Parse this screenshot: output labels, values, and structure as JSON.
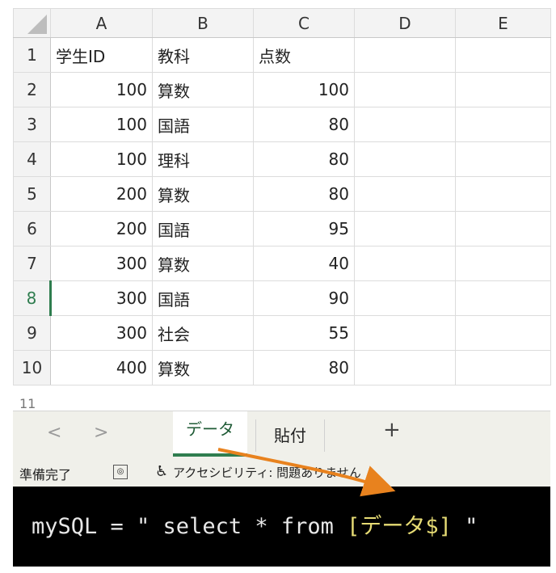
{
  "columns": [
    "A",
    "B",
    "C",
    "D",
    "E"
  ],
  "rows": [
    {
      "num": "1",
      "a": "学生ID",
      "b": "教科",
      "c": "点数"
    },
    {
      "num": "2",
      "a": "100",
      "b": "算数",
      "c": "100"
    },
    {
      "num": "3",
      "a": "100",
      "b": "国語",
      "c": "80"
    },
    {
      "num": "4",
      "a": "100",
      "b": "理科",
      "c": "80"
    },
    {
      "num": "5",
      "a": "200",
      "b": "算数",
      "c": "80"
    },
    {
      "num": "6",
      "a": "200",
      "b": "国語",
      "c": "95"
    },
    {
      "num": "7",
      "a": "300",
      "b": "算数",
      "c": "40"
    },
    {
      "num": "8",
      "a": "300",
      "b": "国語",
      "c": "90"
    },
    {
      "num": "9",
      "a": "300",
      "b": "社会",
      "c": "55"
    },
    {
      "num": "10",
      "a": "400",
      "b": "算数",
      "c": "80"
    }
  ],
  "partial_row_num": "11",
  "sheet_tabs": {
    "prev": "<",
    "next": ">",
    "active": "データ",
    "other": "貼付",
    "add": "+"
  },
  "status": {
    "ready": "準備完了",
    "accessibility": "アクセシビリティ: 問題ありません"
  },
  "code": {
    "prefix": "mySQL = \" select * from ",
    "table_ref": "[データ$]",
    "suffix": " \""
  },
  "colors": {
    "accent_green": "#2f7d4f",
    "arrow_orange": "#e8821e",
    "code_bg": "#000000",
    "code_highlight": "#e6db74"
  },
  "icons": {
    "sheet_status": "sheet-status-icon",
    "accessibility": "accessibility-icon"
  }
}
